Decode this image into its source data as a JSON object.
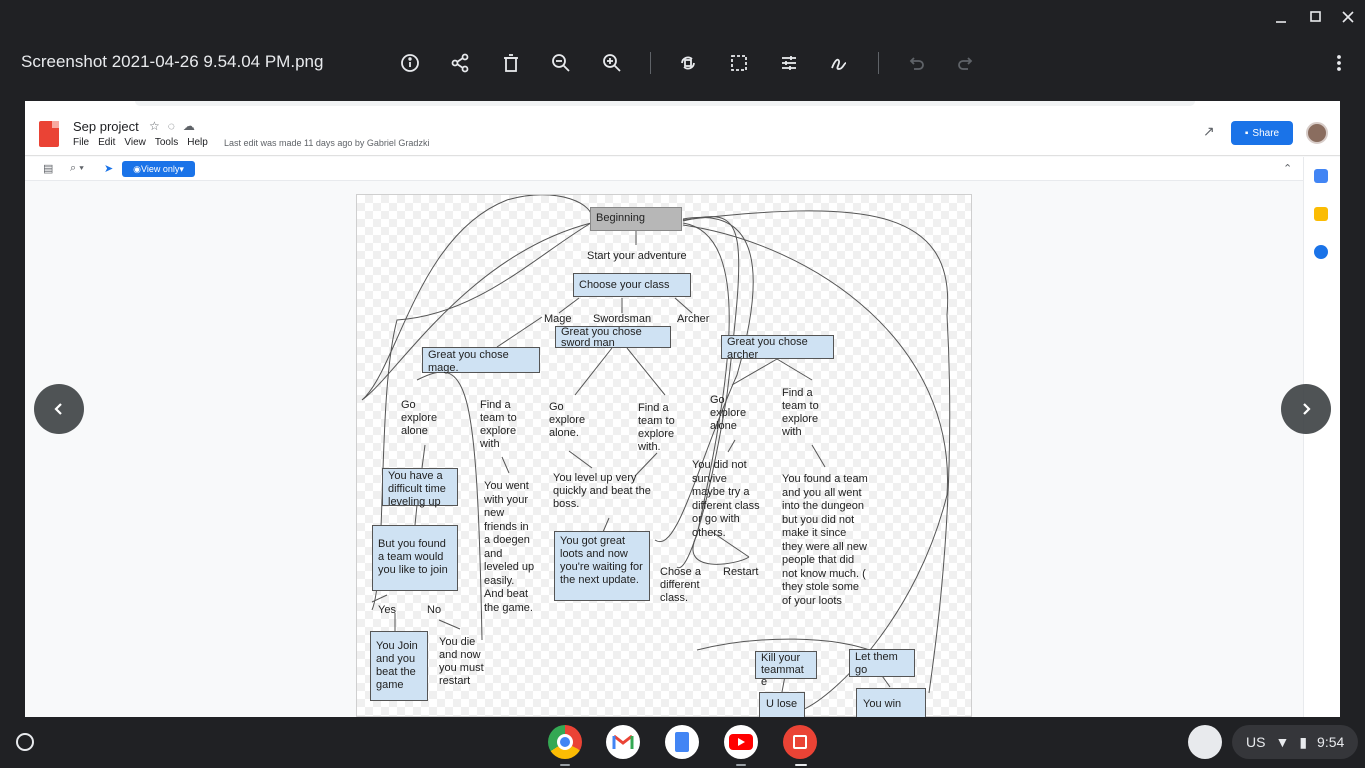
{
  "viewer": {
    "filename": "Screenshot 2021-04-26 9.54.04 PM.png",
    "toolbar_icons": [
      "info-icon",
      "share-icon",
      "delete-icon",
      "zoom-out-icon",
      "zoom-in-icon",
      "rotate-icon",
      "crop-icon",
      "adjust-icon",
      "annotate-icon",
      "undo-icon",
      "redo-icon",
      "more-icon"
    ]
  },
  "doc": {
    "name": "Sep project",
    "menu": [
      "File",
      "Edit",
      "View",
      "Tools",
      "Help"
    ],
    "last_edit": "Last edit was made 11 days ago by Gabriel Gradzki",
    "share_label": "Share",
    "view_only_label": "View only"
  },
  "diagram": {
    "beginning": "Beginning",
    "start": "Start your adventure",
    "choose": "Choose your class",
    "mage": "Mage",
    "swordsman": "Swordsman",
    "archer": "Archer",
    "great_mage": "Great you chose mage.",
    "great_sword": "Great you chose sword man",
    "great_archer": "Great you chose archer",
    "go_alone_1": "Go explore alone",
    "find_team_1": "Find a team to explore with",
    "go_alone_2": "Go explore alone.",
    "find_team_2": "Find a team to explore with.",
    "go_alone_3": "Go explore alone",
    "find_team_3": "Find a team to explore with",
    "difficult": "You have a difficult time leveling up",
    "went_friends": "You went with your new friends in a doegen and leveled up easily. And beat the game.",
    "level_up": "You level up very quickly and beat the boss.",
    "not_survive": "You did not survive maybe try a different class or go with others.",
    "found_team_all": "You found a team and you all went into the dungeon but you did not make it since they were all new people that did not know much. ( they stole some of your loots",
    "found_team_join": "But you found a team would you like to join",
    "great_loots": "You got great loots and now you're waiting for the next update.",
    "chose_diff": "Chose a different class.",
    "restart": "Restart",
    "yes": "Yes",
    "no": "No",
    "join_beat": "You Join and you beat the game",
    "die_restart": "You die and now you must restart",
    "kill_teammate": "Kill your teammat e",
    "let_go": "Let them go",
    "you_lose": "U lose",
    "you_win": "You win"
  },
  "shelf": {
    "apps": [
      "chrome-icon",
      "gmail-icon",
      "docs-icon",
      "youtube-icon",
      "gallery-icon"
    ],
    "ime": "US",
    "time": "9:54"
  },
  "colors": {
    "node_fill": "#cfe2f3",
    "accent": "#1a73e8",
    "dark_bg": "#202124"
  }
}
